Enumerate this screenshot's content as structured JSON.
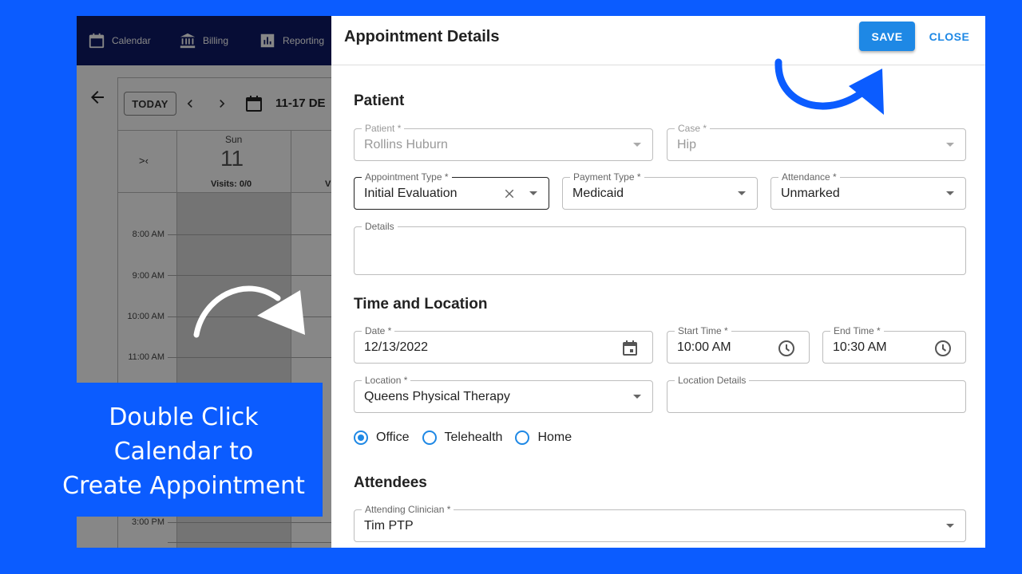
{
  "nav": {
    "calendar": "Calendar",
    "billing": "Billing",
    "reporting": "Reporting"
  },
  "calendar": {
    "today_label": "TODAY",
    "range_label": "11-17 DE",
    "collapse_label": ">‹",
    "day_name": "Sun",
    "day_number": "11",
    "visits": "Visits: 0/0",
    "visits_partial": "V",
    "times": [
      "8:00 AM",
      "9:00 AM",
      "10:00 AM",
      "11:00 AM",
      "3:00 PM"
    ]
  },
  "caption": {
    "text": "Double Click\nCalendar to\nCreate Appointment"
  },
  "dialog": {
    "title": "Appointment Details",
    "save_label": "SAVE",
    "close_label": "CLOSE",
    "sections": {
      "patient": "Patient",
      "time_location": "Time and Location",
      "attendees": "Attendees"
    },
    "fields": {
      "patient": {
        "label": "Patient *",
        "value": "Rollins Huburn"
      },
      "case": {
        "label": "Case *",
        "value": "Hip"
      },
      "appointment_type": {
        "label": "Appointment Type *",
        "value": "Initial Evaluation"
      },
      "payment_type": {
        "label": "Payment Type *",
        "value": "Medicaid"
      },
      "attendance": {
        "label": "Attendance *",
        "value": "Unmarked"
      },
      "details": {
        "label": "Details",
        "value": ""
      },
      "date": {
        "label": "Date *",
        "value": "12/13/2022"
      },
      "start_time": {
        "label": "Start Time *",
        "value": "10:00 AM"
      },
      "end_time": {
        "label": "End Time *",
        "value": "10:30 AM"
      },
      "location": {
        "label": "Location *",
        "value": "Queens Physical Therapy"
      },
      "location_details": {
        "label": "Location Details",
        "value": ""
      },
      "clinician": {
        "label": "Attending Clinician *",
        "value": "Tim PTP"
      }
    },
    "visit_modes": [
      {
        "label": "Office",
        "selected": true
      },
      {
        "label": "Telehealth",
        "selected": false
      },
      {
        "label": "Home",
        "selected": false
      }
    ]
  },
  "colors": {
    "background": "#0b5cff",
    "nav": "#0f1a66",
    "accent": "#1e88e5"
  }
}
